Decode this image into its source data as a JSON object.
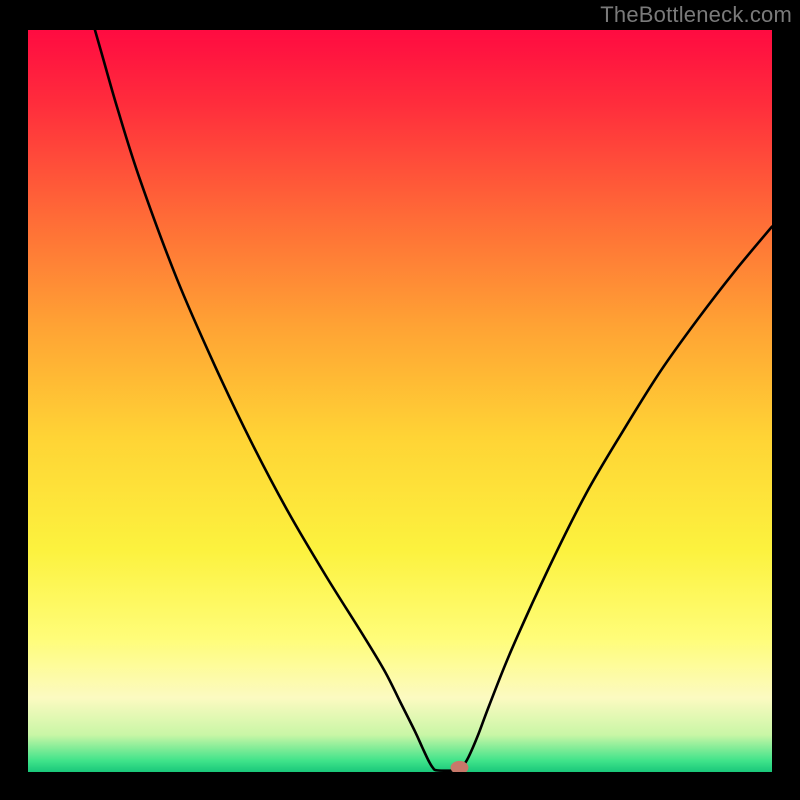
{
  "watermark": "TheBottleneck.com",
  "chart_data": {
    "type": "line",
    "title": "",
    "xlabel": "",
    "ylabel": "",
    "xlim": [
      0,
      100
    ],
    "ylim": [
      0,
      100
    ],
    "grid": false,
    "legend": false,
    "background_gradient": {
      "stops": [
        {
          "offset": 0.0,
          "color": "#ff0b41"
        },
        {
          "offset": 0.1,
          "color": "#ff2d3c"
        },
        {
          "offset": 0.25,
          "color": "#ff6a37"
        },
        {
          "offset": 0.4,
          "color": "#ffa334"
        },
        {
          "offset": 0.55,
          "color": "#ffd435"
        },
        {
          "offset": 0.7,
          "color": "#fcf23e"
        },
        {
          "offset": 0.82,
          "color": "#fffd79"
        },
        {
          "offset": 0.9,
          "color": "#fcfac1"
        },
        {
          "offset": 0.95,
          "color": "#c9f6a6"
        },
        {
          "offset": 0.985,
          "color": "#3fe38a"
        },
        {
          "offset": 1.0,
          "color": "#19c77a"
        }
      ]
    },
    "series": [
      {
        "name": "bottleneck-curve",
        "stroke": "#000000",
        "stroke_width": 2.6,
        "points": [
          {
            "x": 9.0,
            "y": 100.0
          },
          {
            "x": 10.0,
            "y": 96.5
          },
          {
            "x": 12.0,
            "y": 89.5
          },
          {
            "x": 15.0,
            "y": 80.0
          },
          {
            "x": 20.0,
            "y": 66.5
          },
          {
            "x": 25.0,
            "y": 55.0
          },
          {
            "x": 30.0,
            "y": 44.5
          },
          {
            "x": 35.0,
            "y": 35.0
          },
          {
            "x": 40.0,
            "y": 26.5
          },
          {
            "x": 45.0,
            "y": 18.5
          },
          {
            "x": 48.0,
            "y": 13.5
          },
          {
            "x": 50.0,
            "y": 9.5
          },
          {
            "x": 52.0,
            "y": 5.5
          },
          {
            "x": 53.0,
            "y": 3.3
          },
          {
            "x": 53.8,
            "y": 1.6
          },
          {
            "x": 54.4,
            "y": 0.6
          },
          {
            "x": 55.0,
            "y": 0.22
          },
          {
            "x": 57.5,
            "y": 0.22
          },
          {
            "x": 58.3,
            "y": 0.6
          },
          {
            "x": 59.2,
            "y": 2.0
          },
          {
            "x": 60.5,
            "y": 5.0
          },
          {
            "x": 62.0,
            "y": 9.0
          },
          {
            "x": 65.0,
            "y": 16.5
          },
          {
            "x": 70.0,
            "y": 27.5
          },
          {
            "x": 75.0,
            "y": 37.5
          },
          {
            "x": 80.0,
            "y": 46.0
          },
          {
            "x": 85.0,
            "y": 54.0
          },
          {
            "x": 90.0,
            "y": 61.0
          },
          {
            "x": 95.0,
            "y": 67.5
          },
          {
            "x": 100.0,
            "y": 73.5
          }
        ]
      }
    ],
    "marker": {
      "x": 58.0,
      "y": 0.6,
      "color": "#c7786a",
      "rx": 1.2,
      "ry": 0.9
    }
  }
}
